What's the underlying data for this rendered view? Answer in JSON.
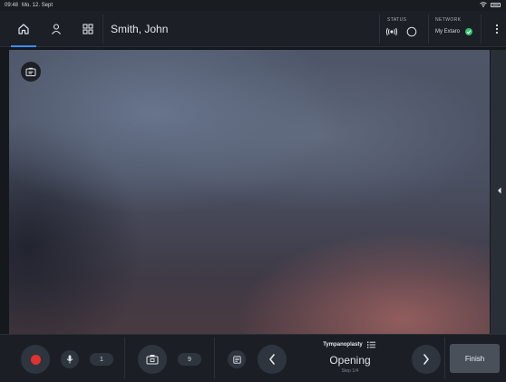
{
  "statusbar": {
    "time": "09:48",
    "date": "Mo. 12. Sept"
  },
  "nav": {
    "home_icon": "home-icon",
    "patient_icon": "person-icon",
    "apps_icon": "grid-icon",
    "patient_name": "Smith, John"
  },
  "status": {
    "label": "STATUS"
  },
  "network": {
    "label": "NETWORK",
    "name": "My Extaro",
    "state_color": "#37c26b"
  },
  "bottom": {
    "mic_count": "1",
    "photo_count": "9",
    "procedure": {
      "title": "Tympanoplasty",
      "step": "Opening",
      "step_count": "Step 1/4"
    },
    "finish_label": "Finish"
  },
  "colors": {
    "accent": "#3d8bff",
    "record": "#e03131",
    "ok": "#37c26b"
  }
}
